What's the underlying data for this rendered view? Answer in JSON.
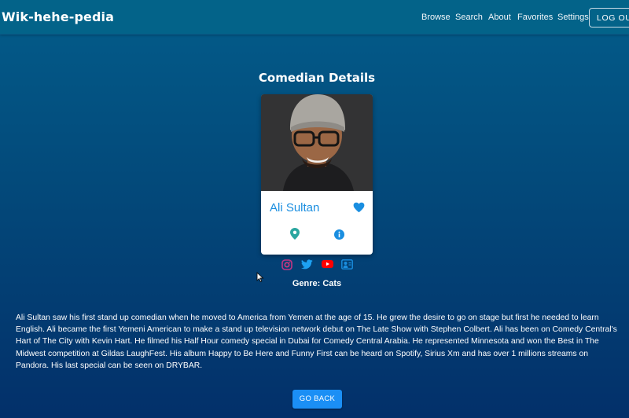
{
  "navbar": {
    "brand": "Wik-hehe-pedia",
    "links": [
      "Browse",
      "Search",
      "About",
      "Favorites",
      "Settings"
    ],
    "logout_label": "LOG OUT"
  },
  "page": {
    "title": "Comedian Details"
  },
  "comedian": {
    "name": "Ali Sultan",
    "favorited": true,
    "genre_text": "Genre: Cats",
    "bio": "Ali Sultan saw his first stand up comedian when he moved to America from Yemen at the age of 15. He grew the desire to go on stage but first he needed to learn English. Ali became the first Yemeni American to make a stand up television network debut on The Late Show with Stephen Colbert. Ali has been on Comedy Central's Hart of The City with Kevin Hart. He filmed his Half Hour comedy special in Dubai for Comedy Central Arabia. He represented Minnesota and won the Best in The Midwest competition at Gildas LaughFest. His album Happy to Be Here and Funny First can be heard on Spotify, Sirius Xm and has over 1 millions streams on Pandora. His last special can be seen on DRYBAR."
  },
  "social_icons": [
    "instagram-icon",
    "twitter-icon",
    "youtube-icon",
    "website-icon"
  ],
  "actions": {
    "back_label": "GO BACK"
  },
  "colors": {
    "navbar": "#036389",
    "accent": "#1a8ee0",
    "button": "#1b8ff5",
    "heart": "#1a8ee0",
    "instagram": "#c13584",
    "twitter": "#1da1f2",
    "youtube": "#ff0000"
  }
}
